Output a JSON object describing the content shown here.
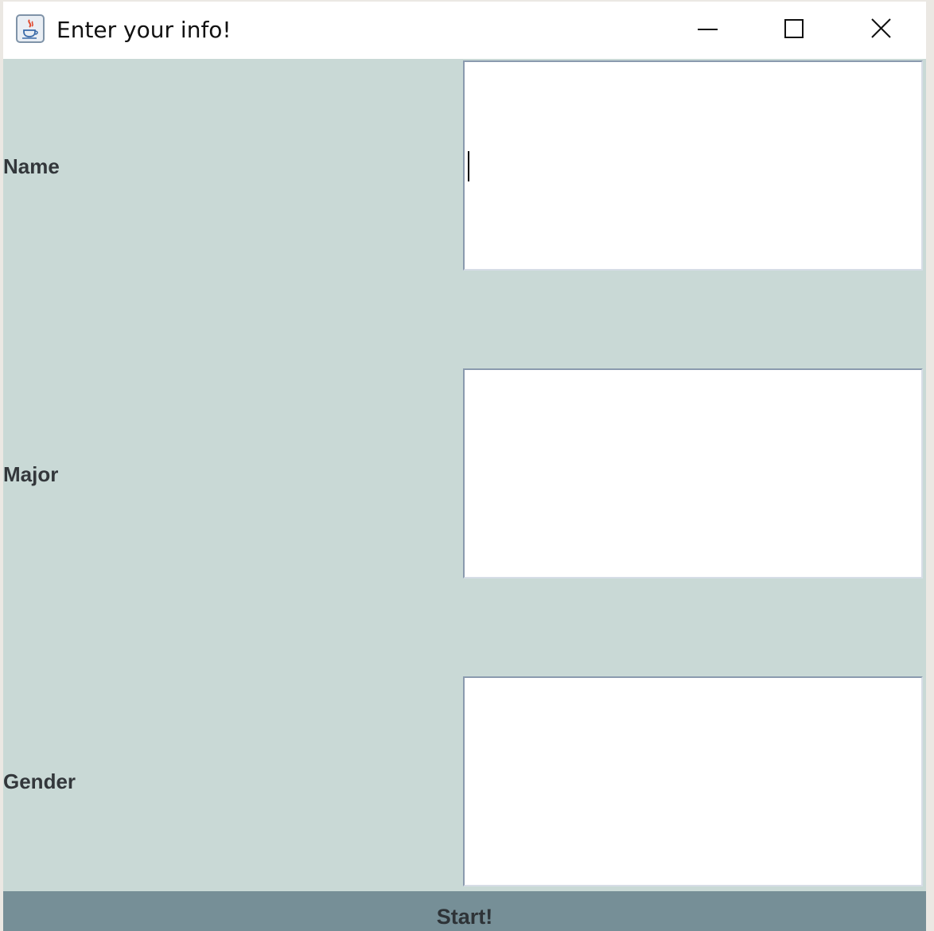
{
  "window": {
    "title": "Enter your info!",
    "icons": {
      "app": "java-app-icon",
      "minimize": "minimize-icon",
      "maximize": "maximize-icon",
      "close": "close-icon"
    }
  },
  "form": {
    "fields": [
      {
        "label": "Name",
        "value": ""
      },
      {
        "label": "Major",
        "value": ""
      },
      {
        "label": "Gender",
        "value": ""
      }
    ],
    "submit_label": "Start!"
  },
  "colors": {
    "panel_background": "#c9d9d6",
    "button_background": "#768f97",
    "label_text": "#33373b"
  }
}
